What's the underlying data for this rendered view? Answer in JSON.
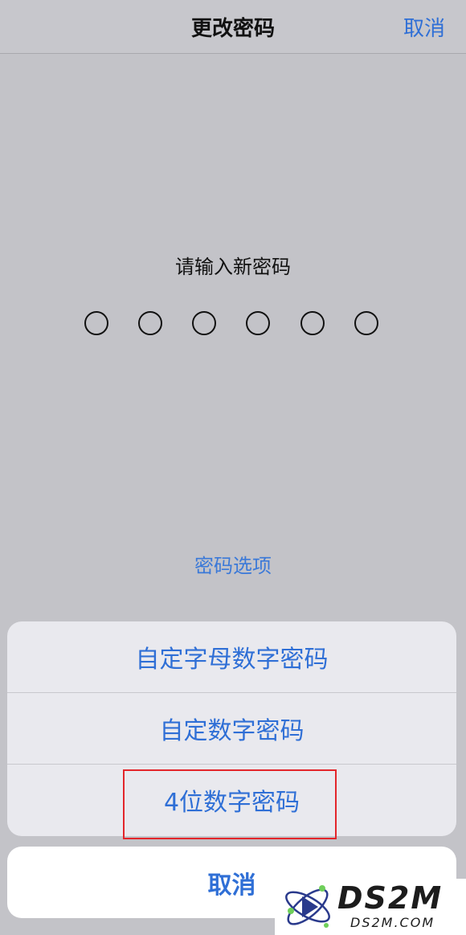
{
  "nav": {
    "title": "更改密码",
    "cancel_label": "取消"
  },
  "prompt": "请输入新密码",
  "passcode_dot_count": 6,
  "options_link": "密码选项",
  "sheet": {
    "items": [
      {
        "label": "自定字母数字密码"
      },
      {
        "label": "自定数字密码"
      },
      {
        "label": "4位数字密码"
      }
    ],
    "cancel_label": "取消"
  },
  "highlight_color": "#e3262b",
  "accent_color": "#2f6fd6",
  "watermark": {
    "main": "DS2M",
    "sub": "DS2M.COM"
  }
}
